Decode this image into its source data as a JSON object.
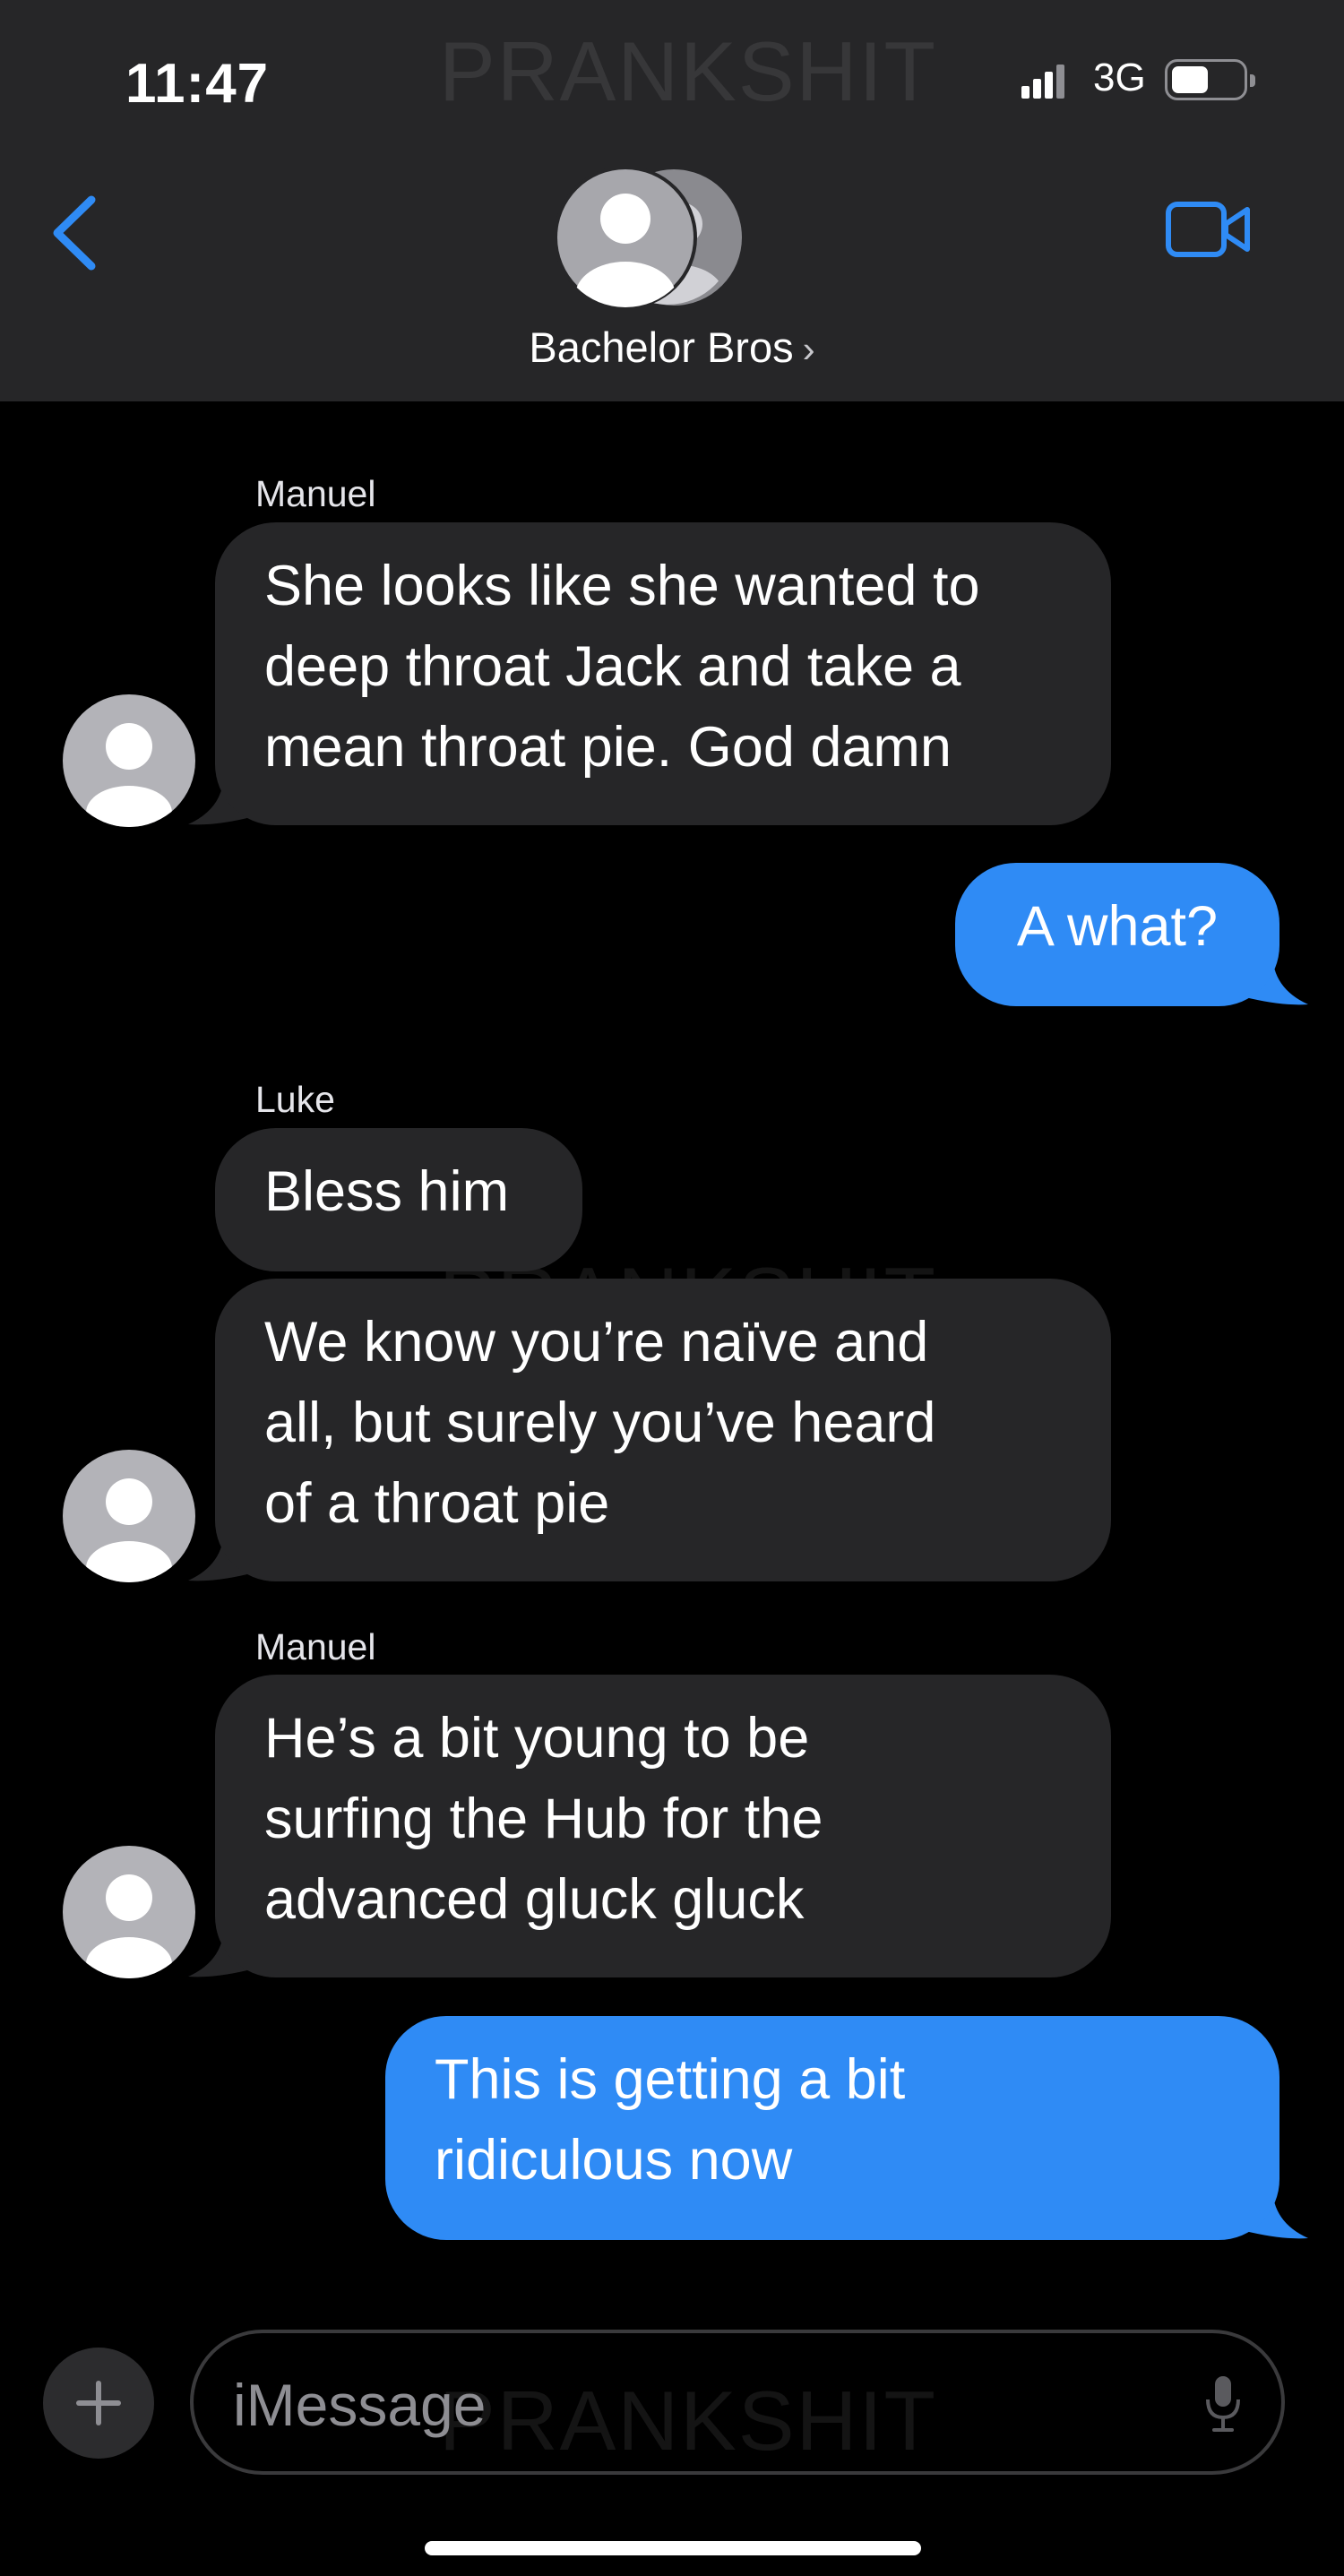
{
  "status_bar": {
    "time": "11:47",
    "network": "3G"
  },
  "header": {
    "title": "Bachelor Bros",
    "chevron": "›"
  },
  "watermark": "PRANKSHIT",
  "messages": [
    {
      "sender": "Manuel",
      "text_lines": [
        "She looks like she wanted to",
        "deep throat Jack and take a",
        "mean throat pie. God damn"
      ]
    },
    {
      "text": "A what?"
    },
    {
      "sender": "Luke",
      "text": "Bless him"
    },
    {
      "text_lines": [
        "We know you’re naïve and",
        "all, but surely you’ve heard",
        "of a throat pie"
      ]
    },
    {
      "sender": "Manuel",
      "text_lines": [
        "He’s a bit young to be",
        "surfing the Hub for the",
        "advanced gluck gluck"
      ]
    },
    {
      "text_lines": [
        "This is getting a bit",
        "ridiculous now"
      ]
    }
  ],
  "composer": {
    "placeholder": "iMessage"
  },
  "colors": {
    "header_bg": "#262628",
    "incoming_bubble": "#262628",
    "outgoing_bubble": "#2f8bf5",
    "accent": "#2f8bf5"
  },
  "icons": [
    "back-chevron-icon",
    "video-call-icon",
    "group-avatar-icon",
    "plus-icon",
    "microphone-icon"
  ]
}
